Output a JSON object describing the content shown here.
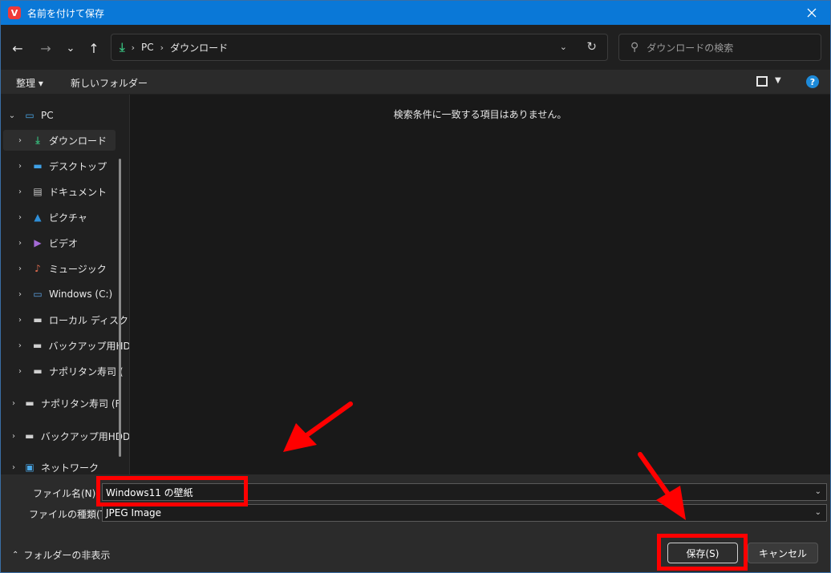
{
  "window": {
    "title": "名前を付けて保存",
    "app_icon_glyph": "V",
    "accent": "#0a78d7"
  },
  "nav": {
    "back_icon": "←",
    "forward_icon": "→",
    "recent_icon": "⌄",
    "up_icon": "↑",
    "breadcrumbs": [
      "PC",
      "ダウンロード"
    ],
    "search_placeholder": "ダウンロードの検索"
  },
  "commands": {
    "organize": "整理",
    "new_folder": "新しいフォルダー"
  },
  "sidebar": {
    "items": [
      {
        "label": "PC",
        "icon": "pc-icon",
        "glyph": "🖥",
        "chev": "⌄"
      },
      {
        "label": "ダウンロード",
        "icon": "download-icon",
        "glyph": "⤓",
        "chev": "›"
      },
      {
        "label": "デスクトップ",
        "icon": "desktop-icon",
        "glyph": "▬",
        "chev": "›"
      },
      {
        "label": "ドキュメント",
        "icon": "document-icon",
        "glyph": "▤",
        "chev": "›"
      },
      {
        "label": "ピクチャ",
        "icon": "pictures-icon",
        "glyph": "▲",
        "chev": "›"
      },
      {
        "label": "ビデオ",
        "icon": "video-icon",
        "glyph": "▶",
        "chev": "›"
      },
      {
        "label": "ミュージック",
        "icon": "music-icon",
        "glyph": "♪",
        "chev": "›"
      },
      {
        "label": "Windows (C:)",
        "icon": "drive-c-icon",
        "glyph": "▭",
        "chev": "›"
      },
      {
        "label": "ローカル ディスク",
        "icon": "drive-icon",
        "glyph": "▬",
        "chev": "›"
      },
      {
        "label": "バックアップ用HD",
        "icon": "drive-icon",
        "glyph": "▬",
        "chev": "›"
      },
      {
        "label": "ナポリタン寿司 (",
        "icon": "drive-icon",
        "glyph": "▬",
        "chev": "›"
      },
      {
        "label": "ナポリタン寿司 (F",
        "icon": "drive-icon",
        "glyph": "▬",
        "chev": "›"
      },
      {
        "label": "バックアップ用HDD",
        "icon": "drive-icon",
        "glyph": "▬",
        "chev": "›"
      },
      {
        "label": "ネットワーク",
        "icon": "network-icon",
        "glyph": "🖧",
        "chev": "›"
      }
    ]
  },
  "main": {
    "empty_message": "検索条件に一致する項目はありません。"
  },
  "form": {
    "filename_label": "ファイル名(N):",
    "filename_value": "Windows11 の壁紙",
    "filetype_label": "ファイルの種類(T):",
    "filetype_value": "JPEG Image",
    "hide_folders": "フォルダーの非表示",
    "save_label": "保存(S)",
    "cancel_label": "キャンセル"
  },
  "annotation_color": "#ff0000"
}
